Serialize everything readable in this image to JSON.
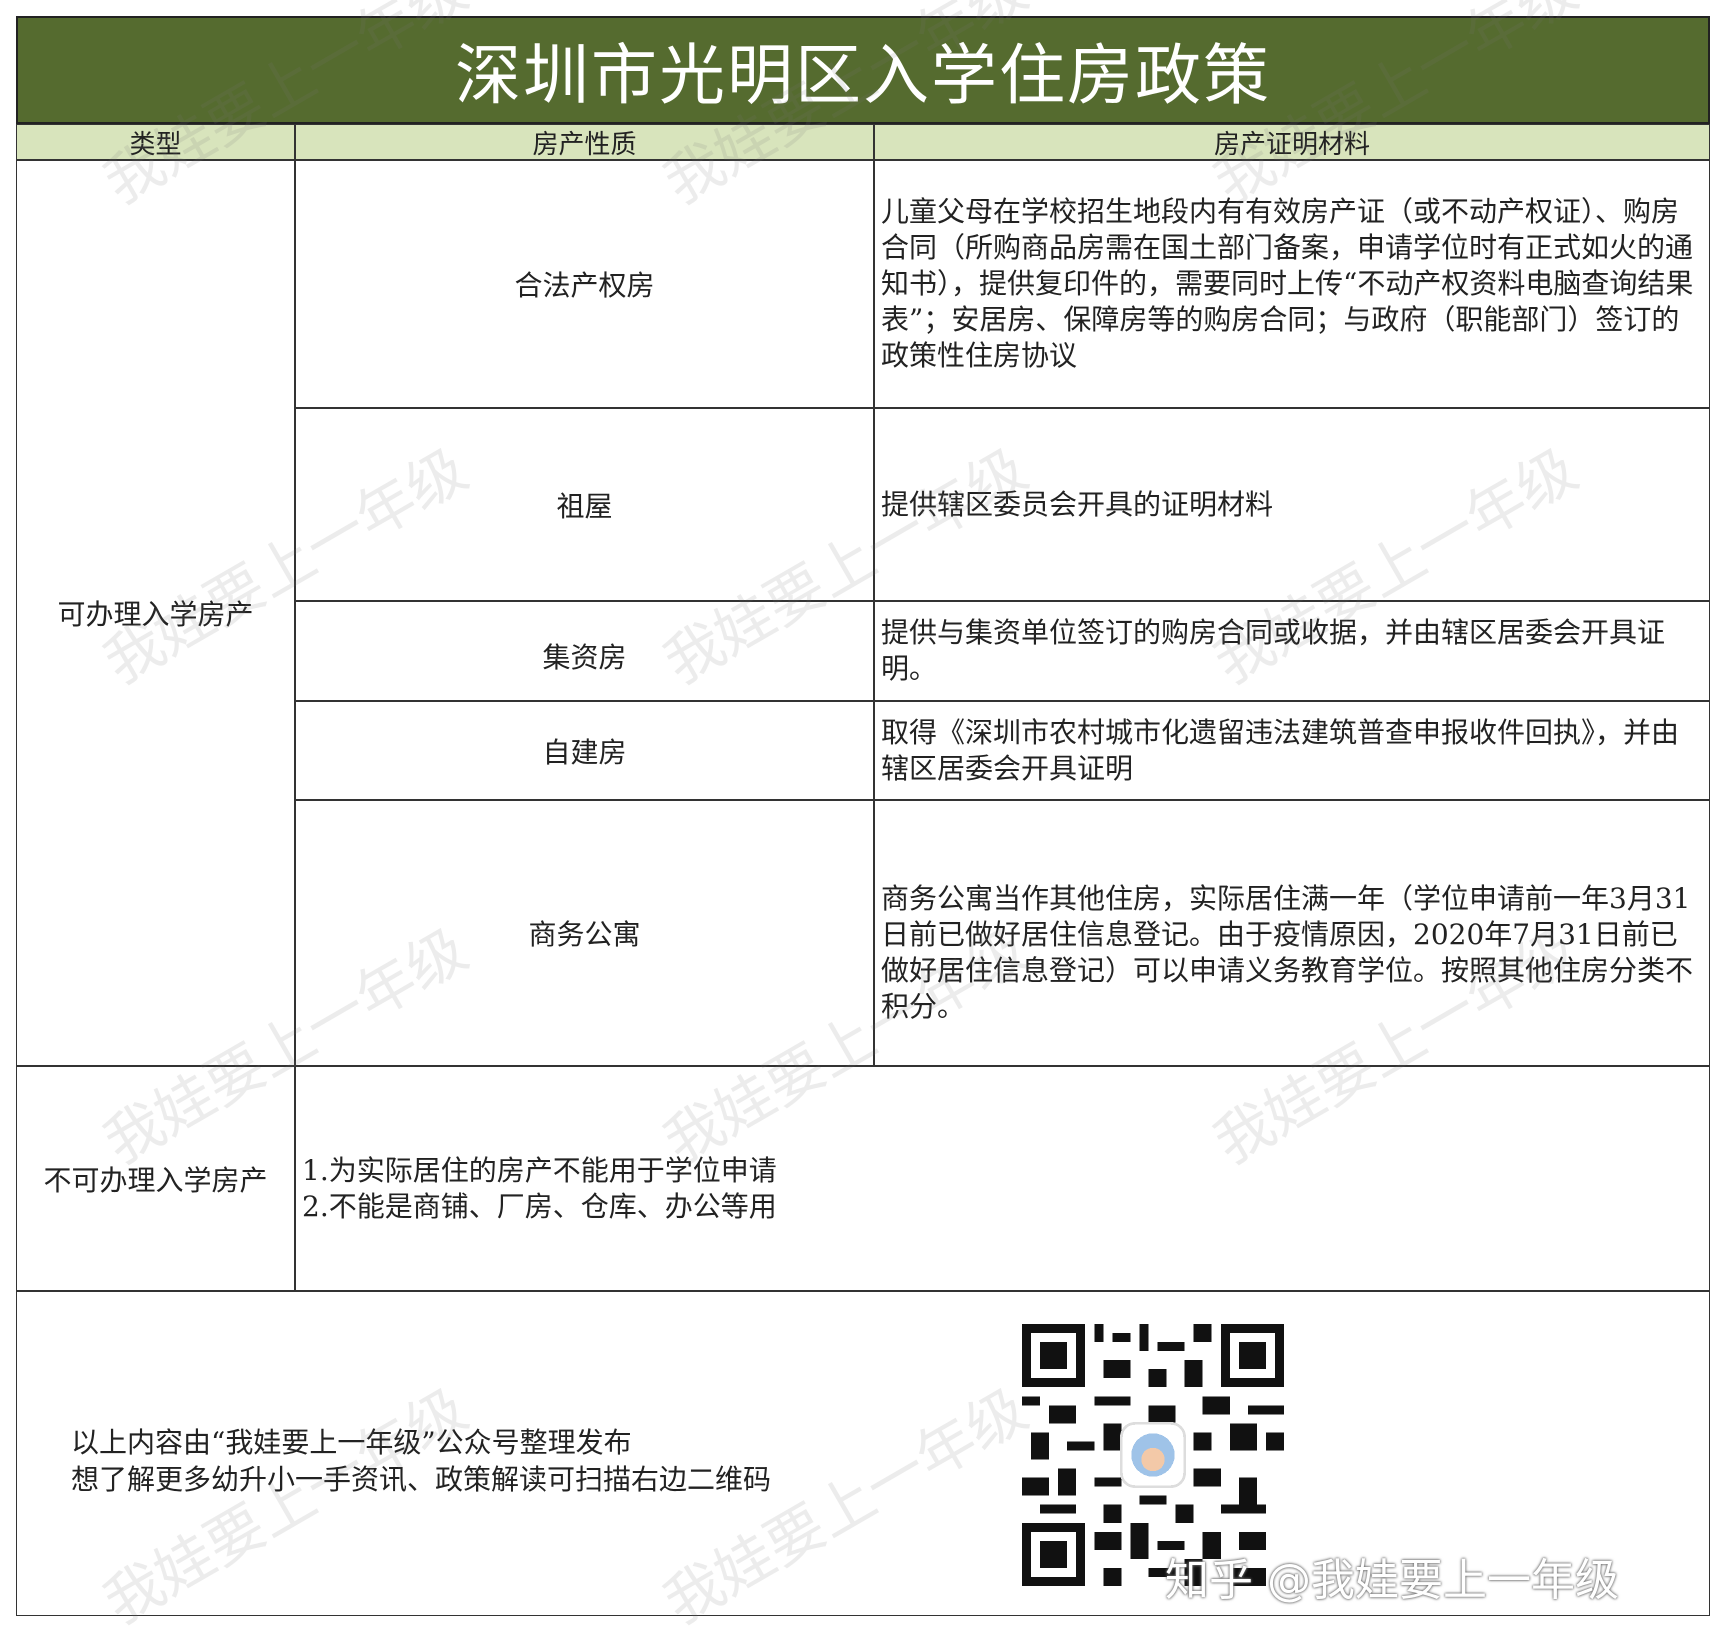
{
  "title": "深圳市光明区入学住房政策",
  "headers": {
    "type": "类型",
    "nature": "房产性质",
    "docs": "房产证明材料"
  },
  "eligible": {
    "label": "可办理入学房产",
    "rows": [
      {
        "nature": "合法产权房",
        "docs": "儿童父母在学校招生地段内有有效房产证（或不动产权证）、购房合同（所购商品房需在国土部门备案，申请学位时有正式如火的通知书），提供复印件的，需要同时上传“不动产权资料电脑查询结果表”；安居房、保障房等的购房合同；与政府（职能部门）签订的政策性住房协议"
      },
      {
        "nature": "祖屋",
        "docs": "提供辖区委员会开具的证明材料"
      },
      {
        "nature": "集资房",
        "docs": "提供与集资单位签订的购房合同或收据，并由辖区居委会开具证明。"
      },
      {
        "nature": "自建房",
        "docs": "取得《深圳市农村城市化遗留违法建筑普查申报收件回执》，并由辖区居委会开具证明"
      },
      {
        "nature": "商务公寓",
        "docs": "商务公寓当作其他住房，实际居住满一年（学位申请前一年3月31日前已做好居住信息登记。由于疫情原因，2020年7月31日前已做好居住信息登记）可以申请义务教育学位。按照其他住房分类不积分。"
      }
    ]
  },
  "ineligible": {
    "label": "不可办理入学房产",
    "items": [
      "1.为实际居住的房产不能用于学位申请",
      "2.不能是商铺、厂房、仓库、办公等用"
    ]
  },
  "footer": {
    "line1": "以上内容由“我娃要上一年级”公众号整理发布",
    "line2": "想了解更多幼升小一手资讯、政策解读可扫描右边二维码",
    "brand": "知乎 @我娃要上一年级",
    "qr_icon": "qr-code"
  },
  "watermark": "我娃要上一年级",
  "colors": {
    "title_bg": "#556b2f",
    "header_bg": "#d8e4bc"
  }
}
